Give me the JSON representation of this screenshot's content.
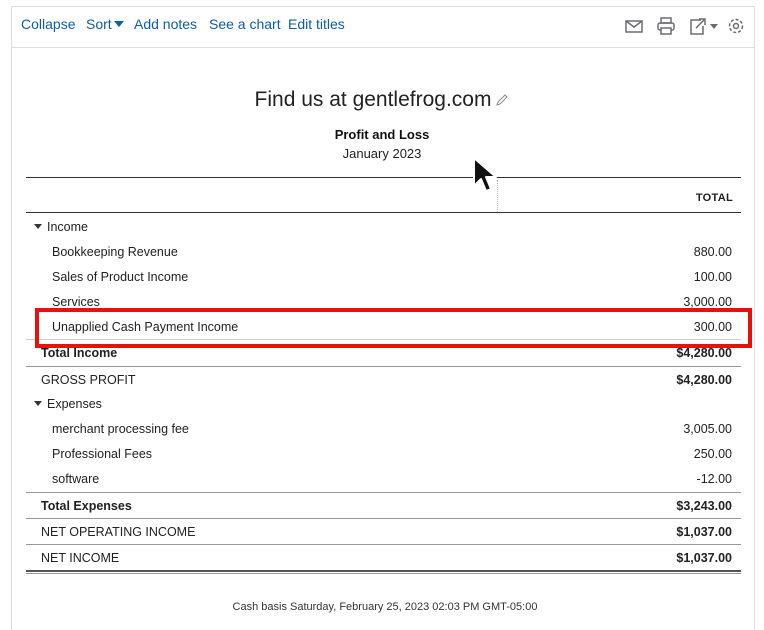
{
  "toolbar": {
    "collapse": "Collapse",
    "sort": "Sort",
    "add_notes": "Add notes",
    "see_chart": "See a chart",
    "edit_titles": "Edit titles",
    "icons": [
      "mail-icon",
      "print-icon",
      "export-icon",
      "gear-icon"
    ]
  },
  "header": {
    "company": "Find us at gentlefrog.com",
    "report_title": "Profit and Loss",
    "period": "January 2023",
    "column_total": "TOTAL"
  },
  "rows": {
    "income": {
      "label": "Income"
    },
    "bookkeeping": {
      "label": "Bookkeeping Revenue",
      "amount": "880.00"
    },
    "sales_product": {
      "label": "Sales of Product Income",
      "amount": "100.00"
    },
    "services": {
      "label": "Services",
      "amount": "3,000.00"
    },
    "unapplied": {
      "label": "Unapplied Cash Payment Income",
      "amount": "300.00"
    },
    "total_income": {
      "label": "Total Income",
      "amount": "$4,280.00"
    },
    "gross_profit": {
      "label": "GROSS PROFIT",
      "amount": "$4,280.00"
    },
    "expenses": {
      "label": "Expenses"
    },
    "merchant_fee": {
      "label": "merchant processing fee",
      "amount": "3,005.00"
    },
    "professional_fees": {
      "label": "Professional Fees",
      "amount": "250.00"
    },
    "software": {
      "label": "software",
      "amount": "-12.00"
    },
    "total_expenses": {
      "label": "Total Expenses",
      "amount": "$3,243.00"
    },
    "net_operating_income": {
      "label": "NET OPERATING INCOME",
      "amount": "$1,037.00"
    },
    "net_income": {
      "label": "NET INCOME",
      "amount": "$1,037.00"
    }
  },
  "footer": {
    "text": "Cash basis  Saturday, February 25, 2023  02:03 PM GMT-05:00"
  },
  "colors": {
    "link": "#0d5ea8",
    "highlight": "#e8120c"
  }
}
